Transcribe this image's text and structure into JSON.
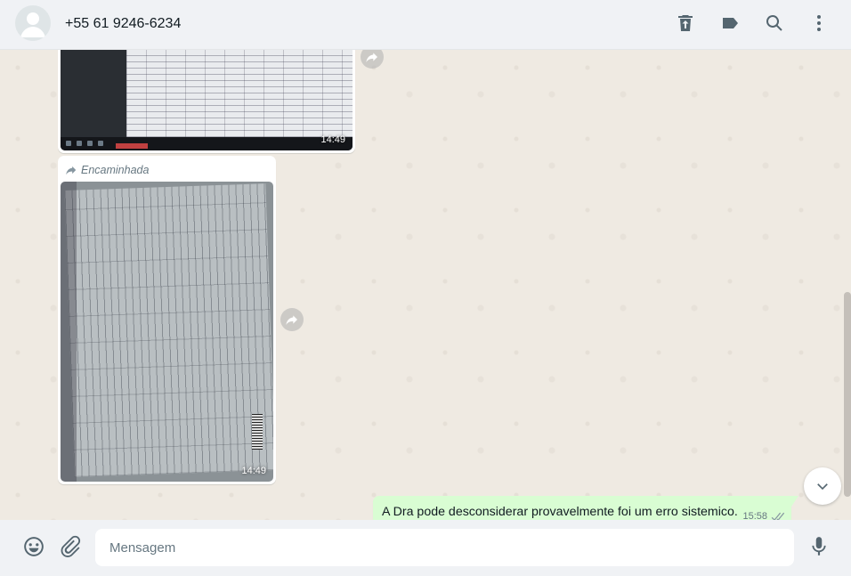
{
  "header": {
    "contact_name": "+55 61 9246-6234",
    "icons": [
      "avatar-icon",
      "delete-icon",
      "label-icon",
      "search-icon",
      "menu-icon"
    ]
  },
  "messages": [
    {
      "type": "image",
      "time": "14:49"
    },
    {
      "type": "image",
      "forwarded_label": "Encaminhada",
      "time": "14:49"
    },
    {
      "type": "text",
      "text": "A Dra pode desconsiderar provavelmente foi um erro sistemico.",
      "time": "15:58",
      "status": "read-ticks"
    }
  ],
  "footer": {
    "input_placeholder": "Mensagem",
    "icons": [
      "emoji-icon",
      "attach-icon",
      "mic-icon"
    ]
  },
  "colors": {
    "chat_bg": "#efeae2",
    "header_bg": "#f0f2f5",
    "outgoing_bubble": "#d9fdd3",
    "icon_gray": "#54656f"
  }
}
